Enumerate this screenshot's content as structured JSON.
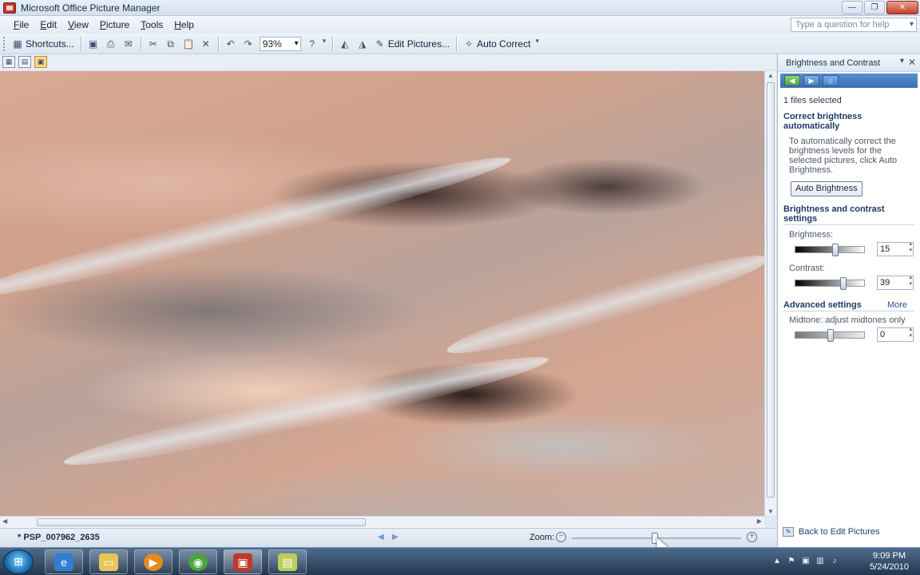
{
  "window": {
    "title": "Microsoft Office Picture Manager",
    "controls": {
      "minimize": "—",
      "maximize": "❐",
      "close": "✕"
    }
  },
  "menu": {
    "items": [
      {
        "label": "File",
        "key": "F",
        "rest": "ile"
      },
      {
        "label": "Edit",
        "key": "E",
        "rest": "dit"
      },
      {
        "label": "View",
        "key": "V",
        "rest": "iew"
      },
      {
        "label": "Picture",
        "key": "P",
        "rest": "icture"
      },
      {
        "label": "Tools",
        "key": "T",
        "rest": "ools"
      },
      {
        "label": "Help",
        "key": "H",
        "rest": "elp"
      }
    ],
    "help_placeholder": "Type a question for help"
  },
  "toolbar": {
    "shortcuts_label": "Shortcuts...",
    "zoom_value": "93%",
    "edit_pictures_label": "Edit Pictures...",
    "auto_correct_label": "Auto Correct"
  },
  "status": {
    "file_name": "* PSP_007962_2635",
    "zoom_label": "Zoom:",
    "zoom_level": 0.49
  },
  "task_pane": {
    "title": "Brightness and Contrast",
    "files_selected": "1 files selected",
    "auto_heading": "Correct brightness automatically",
    "auto_desc": "To automatically correct the brightness levels for the selected pictures, click Auto Brightness.",
    "auto_button": "Auto Brightness",
    "settings_heading": "Brightness and contrast settings",
    "brightness_label": "Brightness:",
    "brightness_value": "15",
    "contrast_label": "Contrast:",
    "contrast_value": "39",
    "advanced_heading": "Advanced settings",
    "more_link": "More",
    "midtone_label": "Midtone: adjust midtones only",
    "midtone_value": "0",
    "back_link": "Back to Edit Pictures"
  },
  "taskbar": {
    "time": "9:09 PM",
    "date": "5/24/2010"
  },
  "colors": {
    "accent": "#3a6fb3",
    "close_button": "#c6412a"
  }
}
